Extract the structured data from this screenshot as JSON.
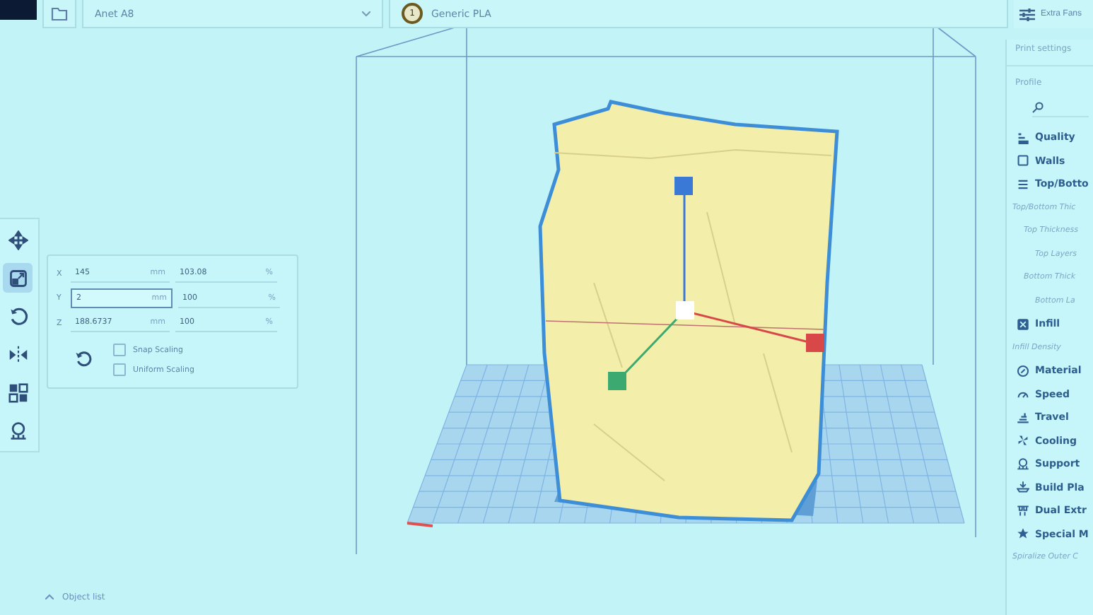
{
  "top_bar": {
    "printer": "Anet A8",
    "material_badge": "1",
    "material": "Generic PLA",
    "settings_button": "Extra Fans"
  },
  "tools": [
    {
      "kind": "move",
      "selected": false
    },
    {
      "kind": "scale",
      "selected": true
    },
    {
      "kind": "rotate",
      "selected": false
    },
    {
      "kind": "mirror",
      "selected": false
    },
    {
      "kind": "per-model",
      "selected": false
    },
    {
      "kind": "support",
      "selected": false
    }
  ],
  "scale_panel": {
    "rows": [
      {
        "axis": "X",
        "value": "145",
        "unit": "mm",
        "percent": "103.08",
        "percent_unit": "%",
        "focused": false
      },
      {
        "axis": "Y",
        "value": "2",
        "unit": "mm",
        "percent": "100",
        "percent_unit": "%",
        "focused": true
      },
      {
        "axis": "Z",
        "value": "188.6737",
        "unit": "mm",
        "percent": "100",
        "percent_unit": "%",
        "focused": false
      }
    ],
    "options": [
      {
        "label": "Snap Scaling",
        "checked": false
      },
      {
        "label": "Uniform Scaling",
        "checked": false
      }
    ]
  },
  "print_settings": {
    "title": "Print settings",
    "profile_label": "Profile",
    "items": [
      {
        "kind": "category",
        "label": "Quality"
      },
      {
        "kind": "category",
        "label": "Walls"
      },
      {
        "kind": "category",
        "label": "Top/Botto",
        "children": [
          {
            "label": "Top/Bottom Thic",
            "children": [
              {
                "label": "Top Thickness",
                "children": [
                  {
                    "label": "Top Layers"
                  }
                ]
              },
              {
                "label": "Bottom Thick",
                "children": [
                  {
                    "label": "Bottom La"
                  }
                ]
              }
            ]
          }
        ]
      },
      {
        "kind": "category",
        "label": "Infill",
        "children": [
          {
            "label": "Infill Density"
          }
        ]
      },
      {
        "kind": "category",
        "label": "Material"
      },
      {
        "kind": "category",
        "label": "Speed"
      },
      {
        "kind": "category",
        "label": "Travel"
      },
      {
        "kind": "category",
        "label": "Cooling"
      },
      {
        "kind": "category",
        "label": "Support"
      },
      {
        "kind": "category",
        "label": "Build Pla"
      },
      {
        "kind": "category",
        "label": "Dual Extr"
      },
      {
        "kind": "category",
        "label": "Special M",
        "children": [
          {
            "label": "Spiralize Outer C"
          }
        ]
      }
    ]
  },
  "object_list": {
    "label": "Object list",
    "expanded": false
  }
}
